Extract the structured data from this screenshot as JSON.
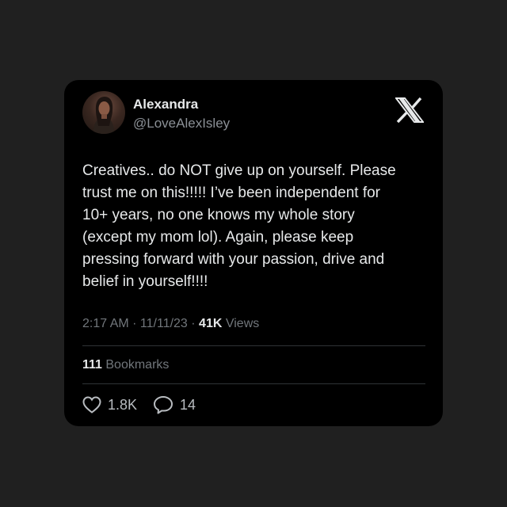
{
  "author": {
    "name": "Alexandra",
    "handle": "@LoveAlexIsley"
  },
  "brand": {
    "icon": "x-logo-icon"
  },
  "tweet": {
    "text": "Creatives.. do NOT give up on yourself. Please\ntrust me on this!!!!! I’ve been independent for\n10+ years, no one knows my whole story\n(except my mom lol). Again, please keep\npressing forward with your passion, drive and\nbelief in yourself!!!!"
  },
  "meta": {
    "time": "2:17 AM",
    "sep1": " · ",
    "date": "11/11/23",
    "sep2": " · ",
    "views_count": "41K",
    "views_label": " Views"
  },
  "bookmarks": {
    "count": "111",
    "label": " Bookmarks"
  },
  "actions": {
    "likes": {
      "icon": "heart-icon",
      "count": "1.8K"
    },
    "replies": {
      "icon": "reply-icon",
      "count": "14"
    }
  },
  "colors": {
    "background": "#202020",
    "card": "#000000",
    "text": "#e7e9ea",
    "secondary": "#71767b"
  }
}
